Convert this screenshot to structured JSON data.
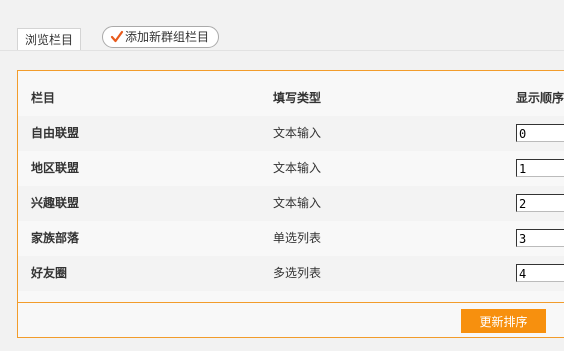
{
  "tabs": {
    "browse_label": "浏览栏目",
    "add_label": "添加新群组栏目"
  },
  "table": {
    "headers": [
      "栏目",
      "填写类型",
      "显示顺序"
    ],
    "rows": [
      {
        "name": "自由联盟",
        "type": "文本输入",
        "order": "0"
      },
      {
        "name": "地区联盟",
        "type": "文本输入",
        "order": "1"
      },
      {
        "name": "兴趣联盟",
        "type": "文本输入",
        "order": "2"
      },
      {
        "name": "家族部落",
        "type": "单选列表",
        "order": "3"
      },
      {
        "name": "好友圈",
        "type": "多选列表",
        "order": "4"
      }
    ]
  },
  "actions": {
    "update_label": "更新排序"
  },
  "colors": {
    "accent": "#f7900e",
    "border": "#f29c2b",
    "check": "#e85a1c"
  },
  "icons": {
    "add_tab": "checkmark-icon"
  }
}
